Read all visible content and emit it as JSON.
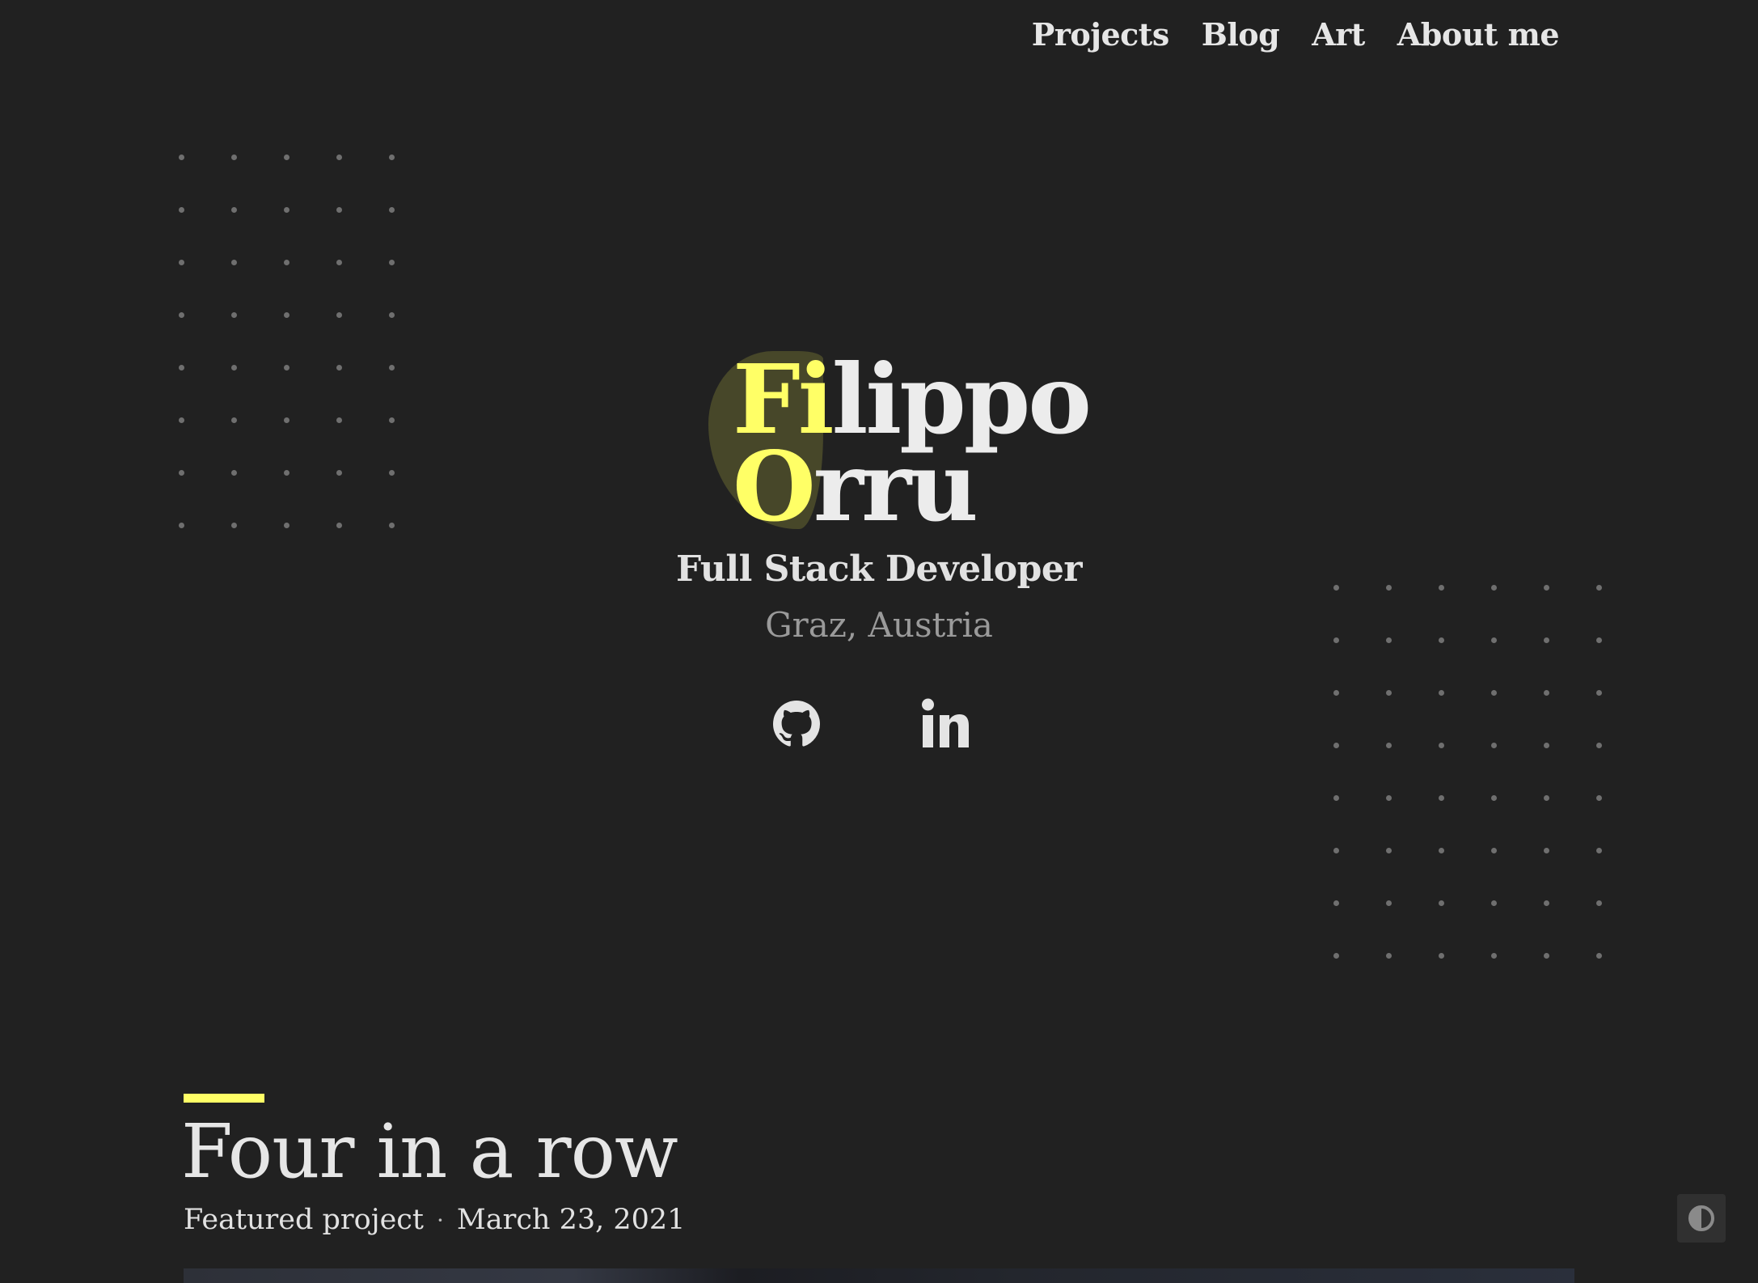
{
  "nav": {
    "items": [
      {
        "label": "Projects"
      },
      {
        "label": "Blog"
      },
      {
        "label": "Art"
      },
      {
        "label": "About me"
      }
    ]
  },
  "hero": {
    "first_name_hl": "Fi",
    "first_name_rest": "lippo",
    "last_name_hl": "O",
    "last_name_rest": "rru",
    "role": "Full Stack Developer",
    "location": "Graz, Austria",
    "social": [
      {
        "name": "github-icon"
      },
      {
        "name": "linkedin-icon"
      }
    ]
  },
  "featured": {
    "title": "Four in a row",
    "category": "Featured project",
    "separator": "·",
    "date": "March 23, 2021"
  },
  "theme_toggle": {
    "icon": "contrast-icon"
  },
  "colors": {
    "background": "#212121",
    "accent": "#ffff66",
    "text": "#e6e6e6",
    "muted": "#9a9a9a"
  }
}
